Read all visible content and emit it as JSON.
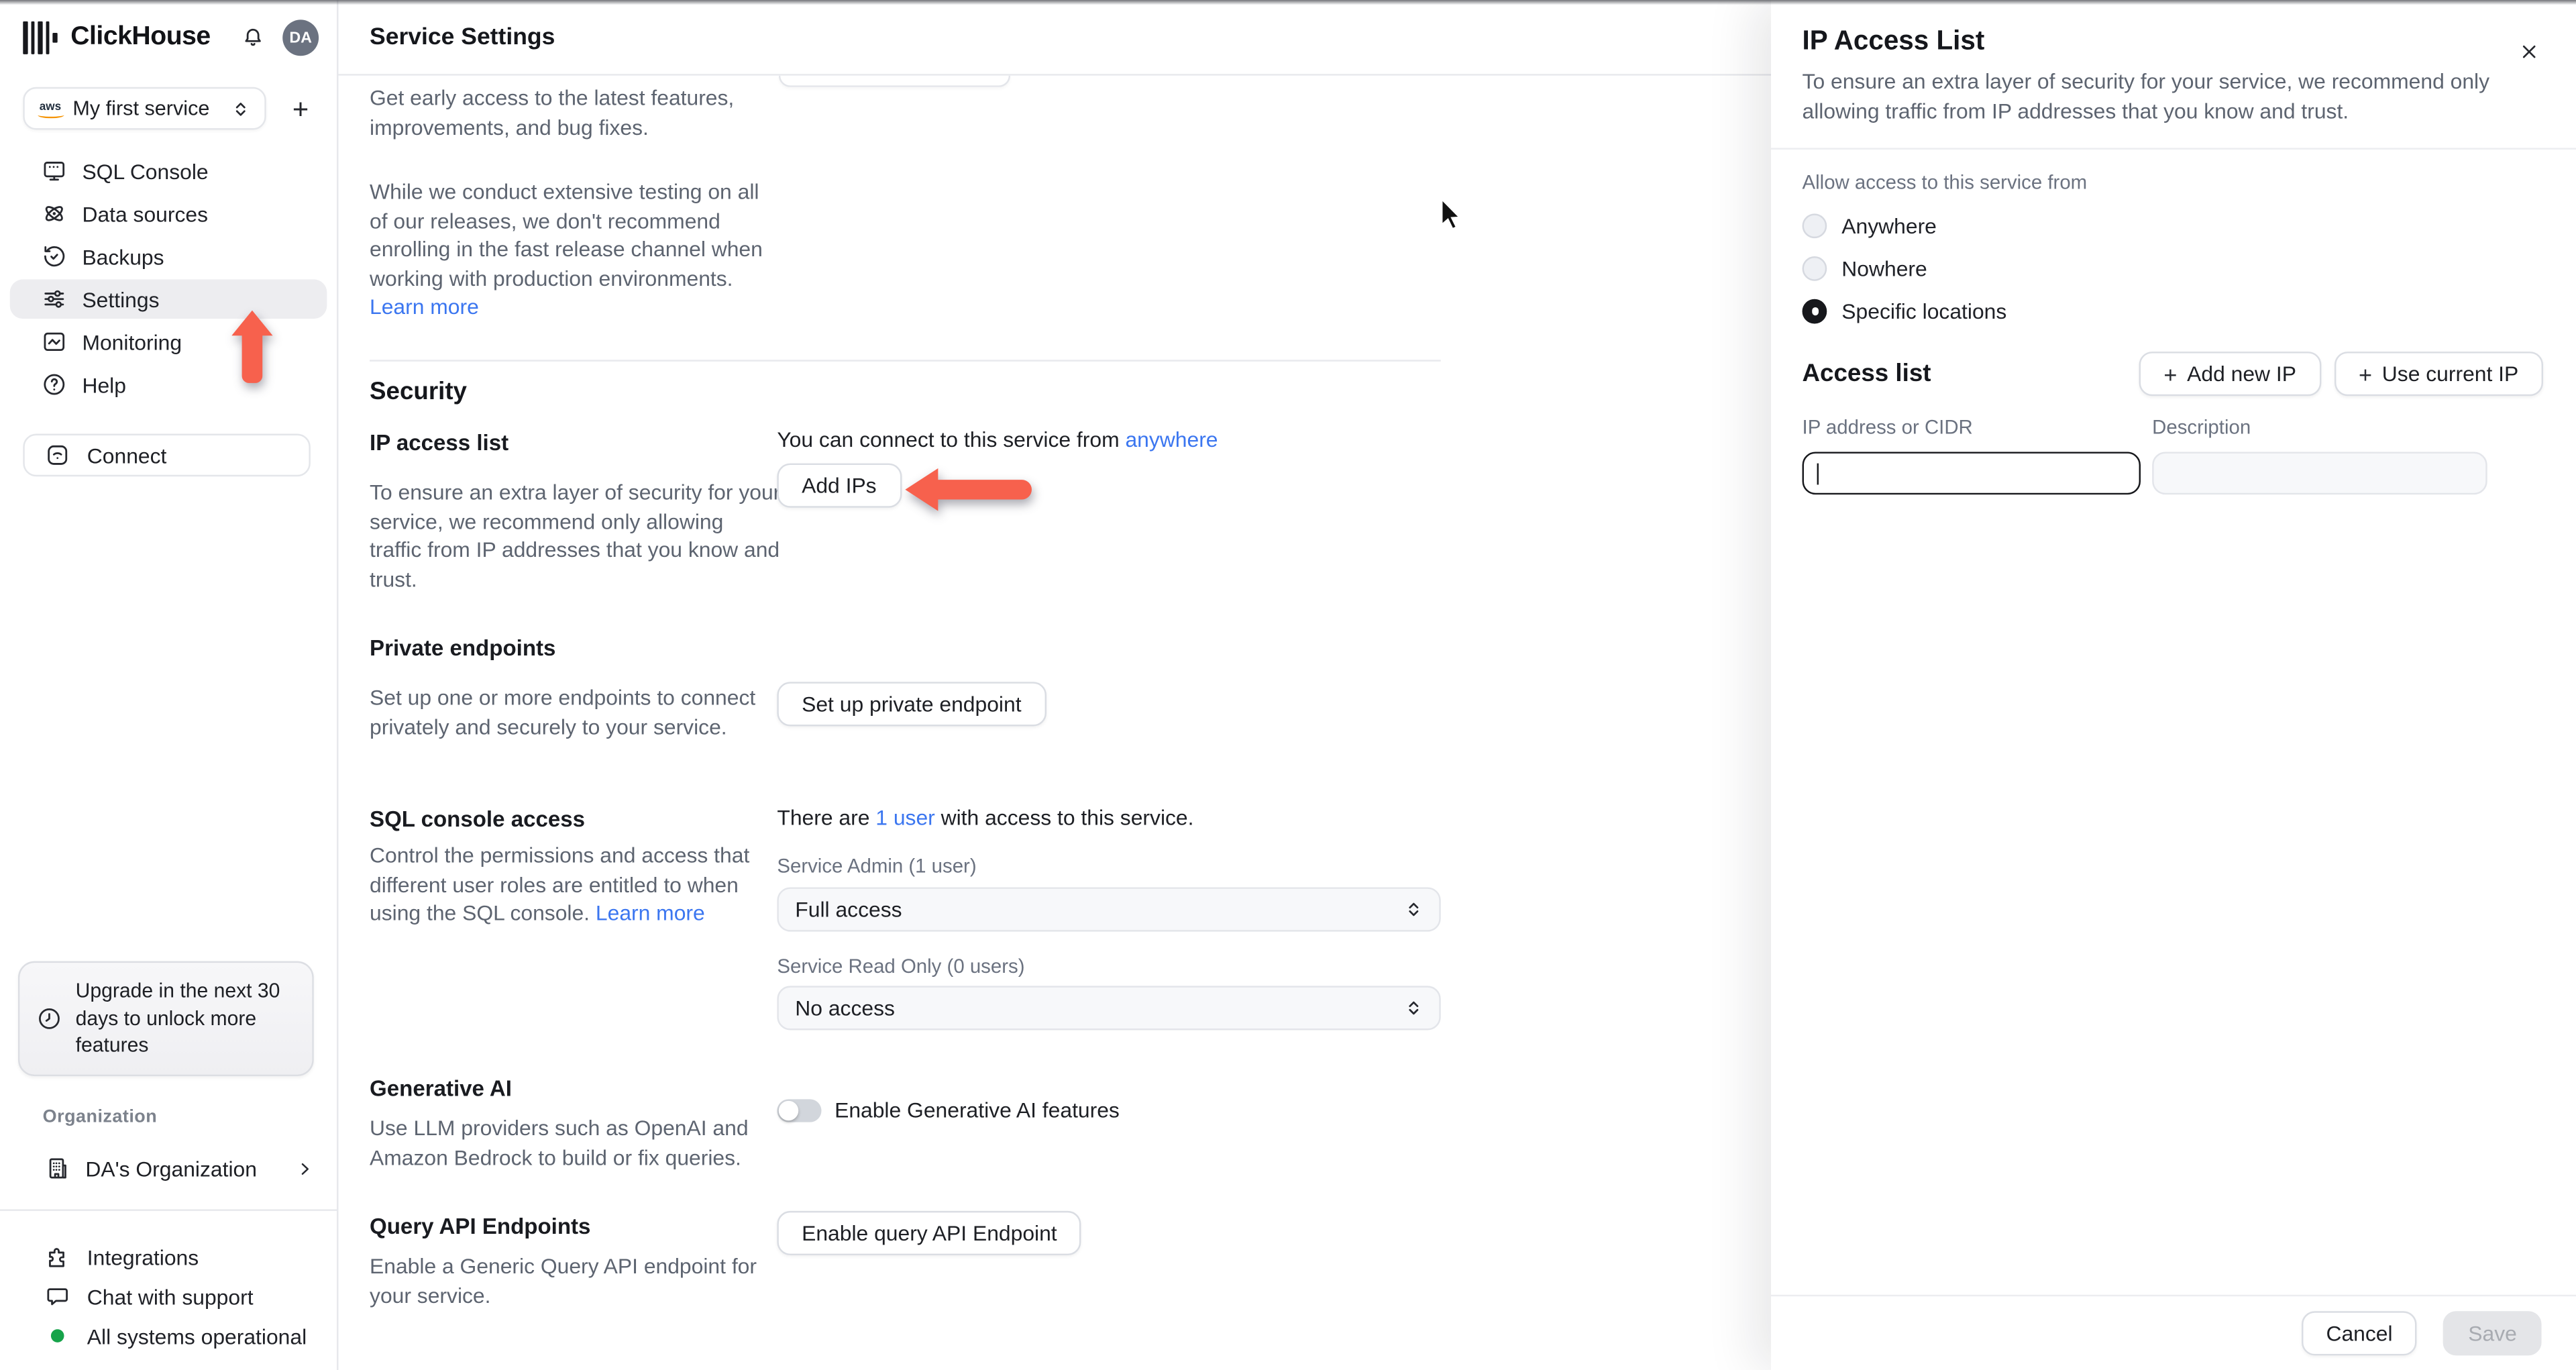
{
  "colors": {
    "accent_red": "#f7614d",
    "link_blue": "#3b76f0",
    "status_green": "#16a34a",
    "avatar_gray": "#6b7280"
  },
  "sidebar": {
    "brand": "ClickHouse",
    "avatar": "DA",
    "service": {
      "name": "My first service",
      "provider": "aws"
    },
    "nav": [
      {
        "label": "SQL Console"
      },
      {
        "label": "Data sources"
      },
      {
        "label": "Backups"
      },
      {
        "label": "Settings"
      },
      {
        "label": "Monitoring"
      },
      {
        "label": "Help"
      }
    ],
    "connect": "Connect",
    "upgrade_notice": "Upgrade in the next 30 days to unlock more features",
    "organization_label": "Organization",
    "organization_name": "DA's Organization",
    "integrations": "Integrations",
    "chat_support": "Chat with support",
    "status": "All systems operational"
  },
  "main": {
    "title": "Service Settings",
    "fast_release": {
      "p1": "Get early access to the latest features, improvements, and bug fixes.",
      "p2": "While we conduct extensive testing on all of our releases, we don't recommend enrolling in the fast release channel when working with production environments. ",
      "learn_more": "Learn more"
    },
    "security_heading": "Security",
    "ip_access": {
      "title": "IP access list",
      "desc": "To ensure an extra layer of security for your service, we recommend only allowing traffic from IP addresses that you know and trust.",
      "connect_prefix": "You can connect to this service from ",
      "connect_link": "anywhere",
      "add_ips": "Add IPs"
    },
    "private_endpoints": {
      "title": "Private endpoints",
      "desc": "Set up one or more endpoints to connect privately and securely to your service.",
      "button": "Set up private endpoint"
    },
    "sql_console": {
      "title": "SQL console access",
      "desc": "Control the permissions and access that different user roles are entitled to when using the SQL console. ",
      "learn_more": "Learn more",
      "users_prefix": "There are ",
      "users_link": "1 user",
      "users_suffix": " with access to this service.",
      "admin_label": "Service Admin (1 user)",
      "admin_value": "Full access",
      "readonly_label": "Service Read Only (0 users)",
      "readonly_value": "No access"
    },
    "generative_ai": {
      "title": "Generative AI",
      "desc": "Use LLM providers such as OpenAI and Amazon Bedrock to build or fix queries.",
      "toggle_label": "Enable Generative AI features"
    },
    "query_api": {
      "title": "Query API Endpoints",
      "desc": "Enable a Generic Query API endpoint for your service.",
      "button": "Enable query API Endpoint"
    }
  },
  "panel": {
    "title": "IP Access List",
    "desc": "To ensure an extra layer of security for your service, we recommend only allowing traffic from IP addresses that you know and trust.",
    "allow_label": "Allow access to this service from",
    "option_anywhere": "Anywhere",
    "option_nowhere": "Nowhere",
    "option_specific": "Specific locations",
    "access_list_heading": "Access list",
    "add_new_ip": "Add new IP",
    "use_current_ip": "Use current IP",
    "ip_label": "IP address or CIDR",
    "description_label": "Description",
    "ip_value": "",
    "description_value": "",
    "cancel": "Cancel",
    "save": "Save"
  }
}
